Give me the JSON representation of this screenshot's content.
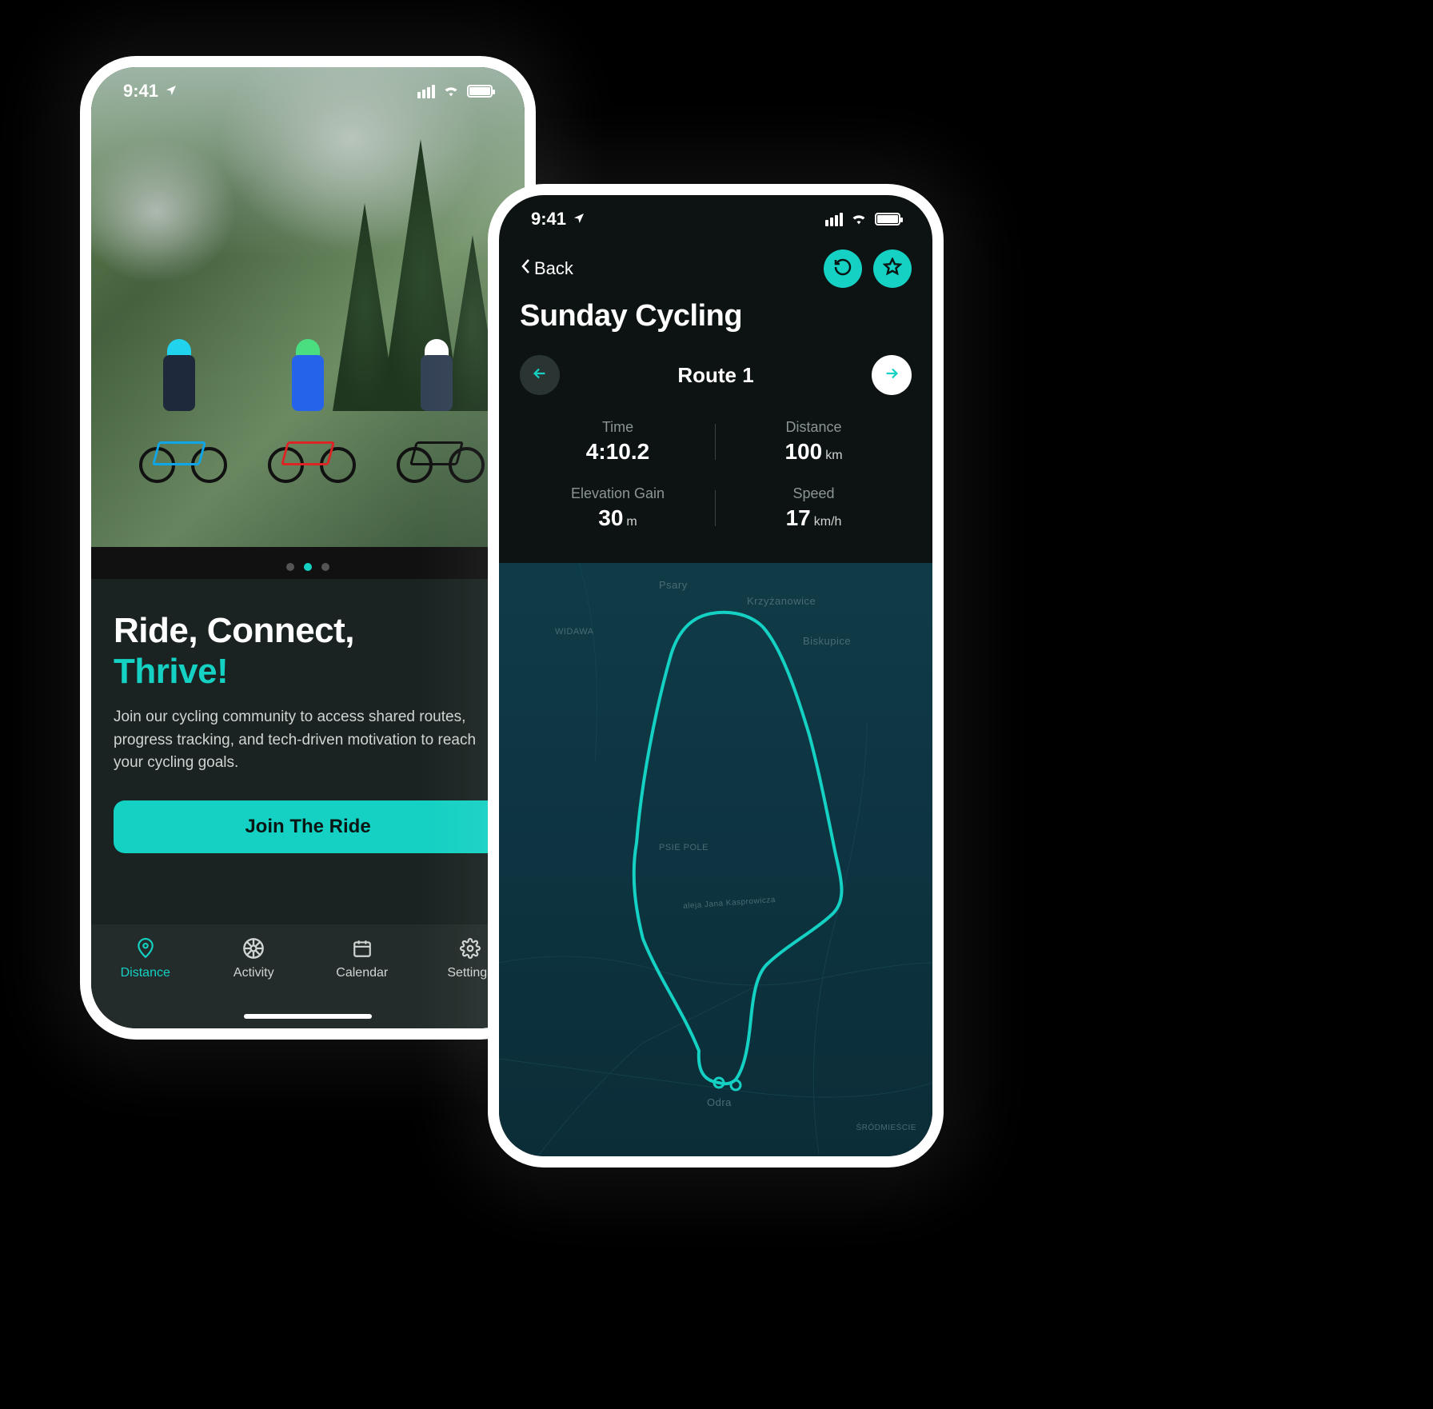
{
  "status": {
    "time": "9:41"
  },
  "left": {
    "headline_line1": "Ride, Connect,",
    "headline_line2": "Thrive!",
    "body": "Join our cycling community to access shared routes, progress tracking, and tech-driven motivation to reach your cycling goals.",
    "cta": "Join The Ride",
    "tabs": {
      "distance": "Distance",
      "activity": "Activity",
      "calendar": "Calendar",
      "settings": "Settings"
    }
  },
  "right": {
    "back": "Back",
    "title": "Sunday Cycling",
    "route": "Route 1",
    "stats": {
      "time_label": "Time",
      "time_value": "4:10.2",
      "distance_label": "Distance",
      "distance_value": "100",
      "distance_unit": "km",
      "elevation_label": "Elevation Gain",
      "elevation_value": "30",
      "elevation_unit": "m",
      "speed_label": "Speed",
      "speed_value": "17",
      "speed_unit": "km/h"
    },
    "map_labels": {
      "psary": "Psary",
      "krzyzanowice": "Krzyżanowice",
      "widawa": "WIDAWA",
      "biskupice": "Biskupice",
      "psie_pole": "PSIE POLE",
      "odra": "Odra",
      "kasprowicza": "aleja Jana Kasprowicza",
      "srodmiescie": "ŚRÓDMIEŚCIE"
    }
  }
}
